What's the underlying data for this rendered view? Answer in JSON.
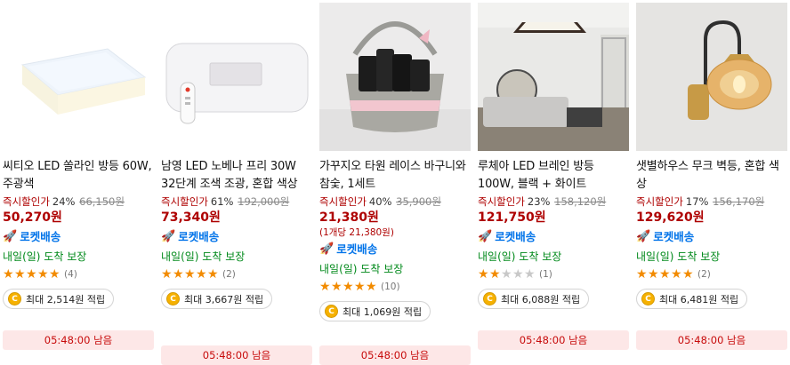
{
  "products": [
    {
      "title": "씨티오 LED 쏠라인 방등 60W, 주광색",
      "discount_label": "즉시할인가",
      "discount_rate": "24%",
      "original_price": "66,150원",
      "price": "50,270원",
      "unit_price": "",
      "rocket_label": "로켓배송",
      "delivery": "내일(일) 도착 보장",
      "rating": 5,
      "review_count": "(4)",
      "reward": "최대 2,514원 적립",
      "timer": "05:48:00 남음",
      "image_icon": "ceiling-light-image"
    },
    {
      "title": "남영 LED 노베나 프리 30W 32단계 조색 조광, 혼합 색상",
      "discount_label": "즉시할인가",
      "discount_rate": "61%",
      "original_price": "192,000원",
      "price": "73,340원",
      "unit_price": "",
      "rocket_label": "로켓배송",
      "delivery": "내일(일) 도착 보장",
      "rating": 5,
      "review_count": "(2)",
      "reward": "최대 3,667원 적립",
      "timer": "05:48:00 남음",
      "image_icon": "led-panel-remote-image"
    },
    {
      "title": "가꾸지오 타원 레이스 바구니와 참숯, 1세트",
      "discount_label": "즉시할인가",
      "discount_rate": "40%",
      "original_price": "35,900원",
      "price": "21,380원",
      "unit_price": "(1개당 21,380원)",
      "rocket_label": "로켓배송",
      "delivery": "내일(일) 도착 보장",
      "rating": 5,
      "review_count": "(10)",
      "reward": "최대 1,069원 적립",
      "timer": "05:48:00 남음",
      "image_icon": "charcoal-basket-image"
    },
    {
      "title": "루체아 LED 브레인 방등 100W, 블랙 + 화이트",
      "discount_label": "즉시할인가",
      "discount_rate": "23%",
      "original_price": "158,120원",
      "price": "121,750원",
      "unit_price": "",
      "rocket_label": "로켓배송",
      "delivery": "내일(일) 도착 보장",
      "rating": 2,
      "review_count": "(1)",
      "reward": "최대 6,088원 적립",
      "timer": "05:48:00 남음",
      "image_icon": "living-room-light-image"
    },
    {
      "title": "샛별하우스 무크 벽등, 혼합 색상",
      "discount_label": "즉시할인가",
      "discount_rate": "17%",
      "original_price": "156,170원",
      "price": "129,620원",
      "unit_price": "",
      "rocket_label": "로켓배송",
      "delivery": "내일(일) 도착 보장",
      "rating": 5,
      "review_count": "(2)",
      "reward": "최대 6,481원 적립",
      "timer": "05:48:00 남음",
      "image_icon": "wall-lamp-image"
    }
  ],
  "colors": {
    "price_red": "#ae0000",
    "rocket_blue": "#0073e9",
    "delivery_green": "#00891a",
    "star_orange": "#f28b00",
    "timer_bg": "#fde7e7"
  }
}
